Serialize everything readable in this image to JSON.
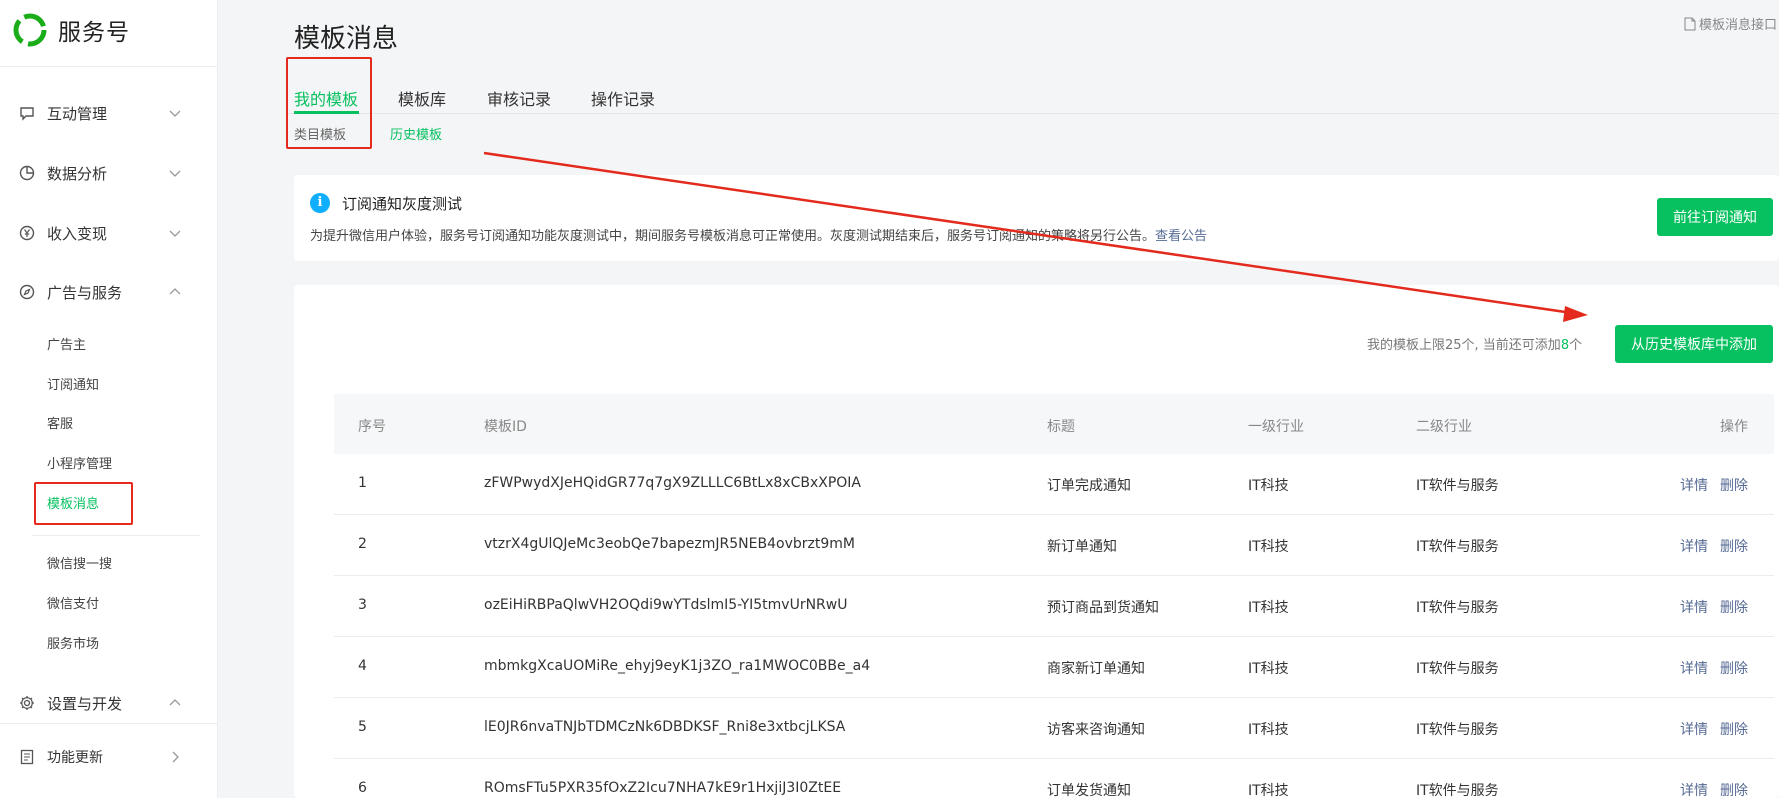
{
  "brand": {
    "name": "服务号"
  },
  "sidebar": {
    "groups": [
      {
        "label": "互动管理",
        "icon": "chat-bubble-icon",
        "expanded": false
      },
      {
        "label": "数据分析",
        "icon": "pie-chart-icon",
        "expanded": false
      },
      {
        "label": "收入变现",
        "icon": "yen-coin-icon",
        "expanded": false
      },
      {
        "label": "广告与服务",
        "icon": "compass-icon",
        "expanded": true
      },
      {
        "label": "设置与开发",
        "icon": "gear-icon",
        "expanded": true
      },
      {
        "label": "功能更新",
        "icon": "notebook-icon",
        "expanded": false
      }
    ],
    "ads_items": [
      "广告主",
      "订阅通知",
      "客服",
      "小程序管理",
      "模板消息"
    ],
    "service_items": [
      "微信搜一搜",
      "微信支付",
      "服务市场"
    ],
    "active_item": "模板消息"
  },
  "header": {
    "title": "模板消息",
    "doc_link": "模板消息接口"
  },
  "tabs": [
    {
      "label": "我的模板",
      "active": true
    },
    {
      "label": "模板库",
      "active": false
    },
    {
      "label": "审核记录",
      "active": false
    },
    {
      "label": "操作记录",
      "active": false
    }
  ],
  "subtabs": [
    {
      "label": "类目模板",
      "active": true
    },
    {
      "label": "历史模板",
      "active": false
    }
  ],
  "notice": {
    "title": "订阅通知灰度测试",
    "desc": "为提升微信用户体验，服务号订阅通知功能灰度测试中，期间服务号模板消息可正常使用。灰度测试期结束后，服务号订阅通知的策略将另行公告。",
    "link": "查看公告",
    "button": "前往订阅通知"
  },
  "limit": {
    "prefix": "我的模板上限25个, 当前还可添加",
    "count": "8",
    "suffix": "个"
  },
  "add_button": "从历史模板库中添加",
  "table": {
    "headers": [
      "序号",
      "模板ID",
      "标题",
      "一级行业",
      "二级行业",
      "操作"
    ],
    "rows": [
      [
        "1",
        "zFWPwydXJeHQidGR77q7gX9ZLLLC6BtLx8xCBxXPOIA",
        "订单完成通知",
        "IT科技",
        "IT软件与服务"
      ],
      [
        "2",
        "vtzrX4gUlQJeMc3eobQe7bapezmJR5NEB4ovbrzt9mM",
        "新订单通知",
        "IT科技",
        "IT软件与服务"
      ],
      [
        "3",
        "ozEiHiRBPaQlwVH2OQdi9wYTdslmI5-YI5tmvUrNRwU",
        "预订商品到货通知",
        "IT科技",
        "IT软件与服务"
      ],
      [
        "4",
        "mbmkgXcaUOMiRe_ehyj9eyK1j3ZO_ra1MWOC0BBe_a4",
        "商家新订单通知",
        "IT科技",
        "IT软件与服务"
      ],
      [
        "5",
        "lE0JR6nvaTNJbTDMCzNk6DBDKSF_Rni8e3xtbcjLKSA",
        "访客来咨询通知",
        "IT科技",
        "IT软件与服务"
      ],
      [
        "6",
        "ROmsFTu5PXR35fOxZ2Icu7NHA7kE9r1HxjiJ3I0ZtEE",
        "订单发货通知",
        "IT科技",
        "IT软件与服务"
      ]
    ],
    "op_detail": "详情",
    "op_delete": "删除"
  },
  "colors": {
    "accent": "#07c160",
    "link": "#576b95",
    "annotation": "#e32a1d",
    "info": "#10aeff"
  }
}
